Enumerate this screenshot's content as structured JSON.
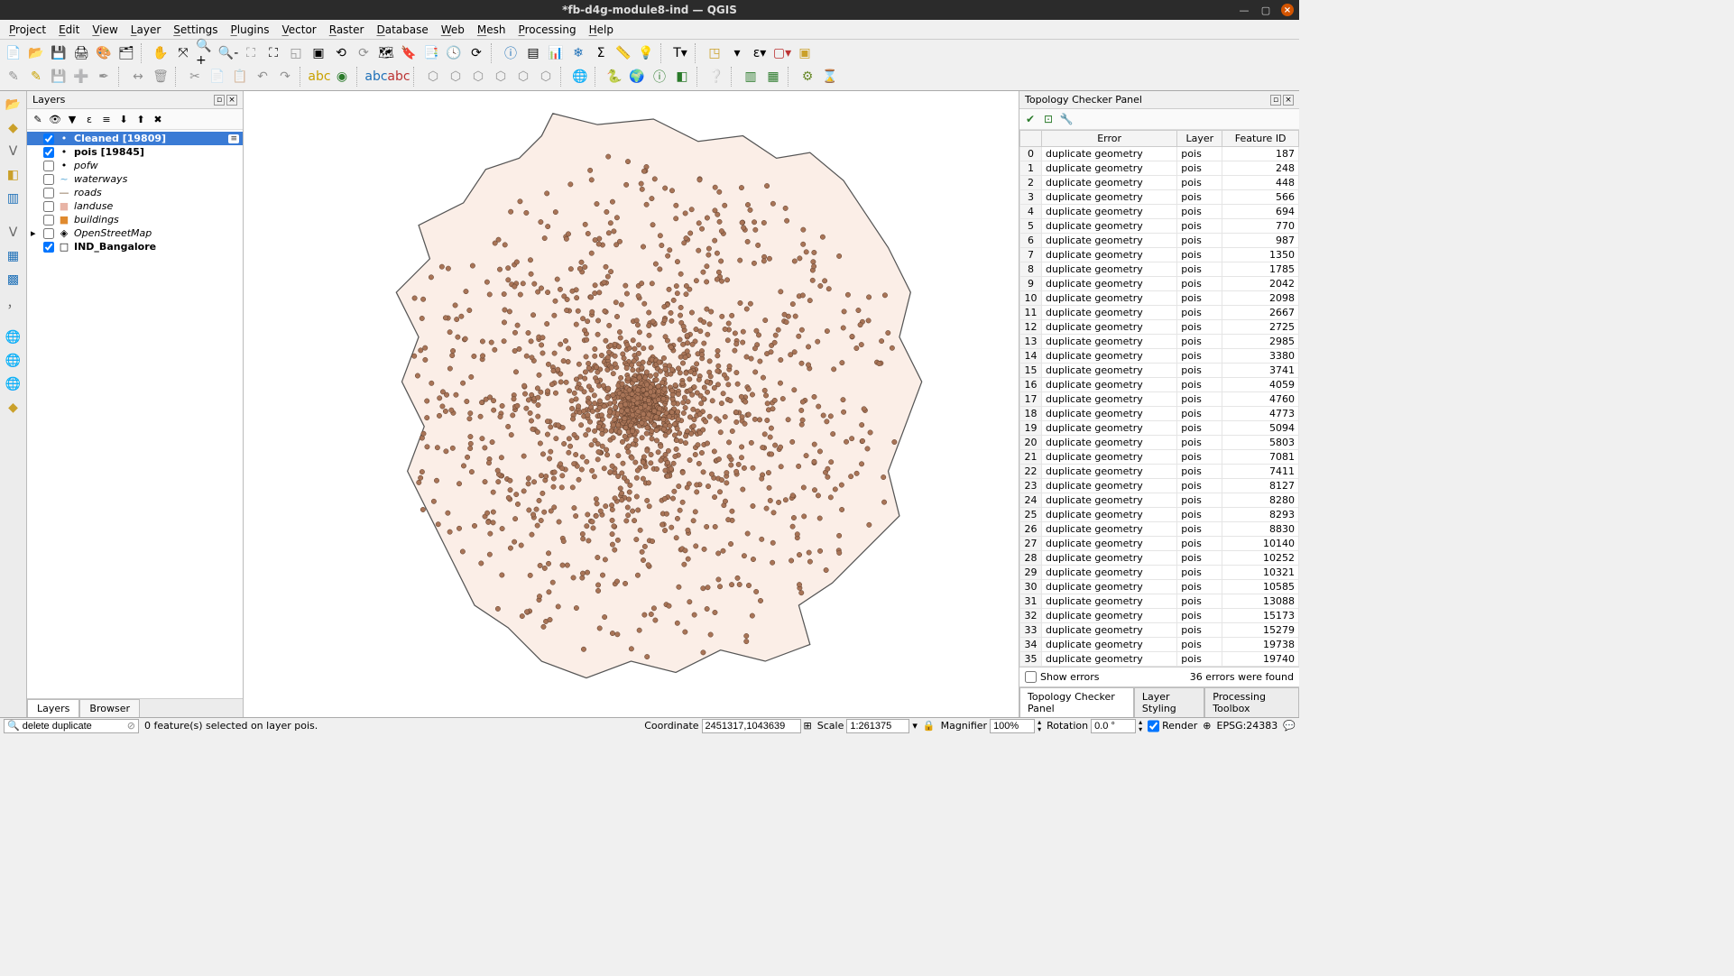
{
  "window": {
    "title": "*fb-d4g-module8-ind — QGIS"
  },
  "menu": [
    "Project",
    "Edit",
    "View",
    "Layer",
    "Settings",
    "Plugins",
    "Vector",
    "Raster",
    "Database",
    "Web",
    "Mesh",
    "Processing",
    "Help"
  ],
  "layersPanel": {
    "title": "Layers",
    "items": [
      {
        "checked": true,
        "sym": "•",
        "label": "Cleaned [19809]",
        "selected": true,
        "bold": true
      },
      {
        "checked": true,
        "sym": "•",
        "label": "pois [19845]",
        "bold": true
      },
      {
        "checked": false,
        "sym": "•",
        "label": "pofw",
        "italic": true
      },
      {
        "checked": false,
        "sym": "~",
        "label": "waterways",
        "italic": true,
        "symcolor": "#5aa9d6"
      },
      {
        "checked": false,
        "sym": "—",
        "label": "roads",
        "italic": true,
        "symcolor": "#7a5a3a"
      },
      {
        "checked": false,
        "sym": "■",
        "label": "landuse",
        "italic": true,
        "symcolor": "#e8b4a6"
      },
      {
        "checked": false,
        "sym": "■",
        "label": "buildings",
        "italic": true,
        "symcolor": "#e08a2e"
      },
      {
        "checked": false,
        "sym": "◈",
        "label": "OpenStreetMap",
        "italic": true,
        "expandable": true
      },
      {
        "checked": true,
        "sym": "□",
        "label": "IND_Bangalore",
        "bold": true
      }
    ],
    "tabs": [
      "Layers",
      "Browser"
    ]
  },
  "topologyPanel": {
    "title": "Topology Checker Panel",
    "columns": [
      "Error",
      "Layer",
      "Feature ID"
    ],
    "rows": [
      [
        "duplicate geometry",
        "pois",
        187
      ],
      [
        "duplicate geometry",
        "pois",
        248
      ],
      [
        "duplicate geometry",
        "pois",
        448
      ],
      [
        "duplicate geometry",
        "pois",
        566
      ],
      [
        "duplicate geometry",
        "pois",
        694
      ],
      [
        "duplicate geometry",
        "pois",
        770
      ],
      [
        "duplicate geometry",
        "pois",
        987
      ],
      [
        "duplicate geometry",
        "pois",
        1350
      ],
      [
        "duplicate geometry",
        "pois",
        1785
      ],
      [
        "duplicate geometry",
        "pois",
        2042
      ],
      [
        "duplicate geometry",
        "pois",
        2098
      ],
      [
        "duplicate geometry",
        "pois",
        2667
      ],
      [
        "duplicate geometry",
        "pois",
        2725
      ],
      [
        "duplicate geometry",
        "pois",
        2985
      ],
      [
        "duplicate geometry",
        "pois",
        3380
      ],
      [
        "duplicate geometry",
        "pois",
        3741
      ],
      [
        "duplicate geometry",
        "pois",
        4059
      ],
      [
        "duplicate geometry",
        "pois",
        4760
      ],
      [
        "duplicate geometry",
        "pois",
        4773
      ],
      [
        "duplicate geometry",
        "pois",
        5094
      ],
      [
        "duplicate geometry",
        "pois",
        5803
      ],
      [
        "duplicate geometry",
        "pois",
        7081
      ],
      [
        "duplicate geometry",
        "pois",
        7411
      ],
      [
        "duplicate geometry",
        "pois",
        8127
      ],
      [
        "duplicate geometry",
        "pois",
        8280
      ],
      [
        "duplicate geometry",
        "pois",
        8293
      ],
      [
        "duplicate geometry",
        "pois",
        8830
      ],
      [
        "duplicate geometry",
        "pois",
        10140
      ],
      [
        "duplicate geometry",
        "pois",
        10252
      ],
      [
        "duplicate geometry",
        "pois",
        10321
      ],
      [
        "duplicate geometry",
        "pois",
        10585
      ],
      [
        "duplicate geometry",
        "pois",
        13088
      ],
      [
        "duplicate geometry",
        "pois",
        15173
      ],
      [
        "duplicate geometry",
        "pois",
        15279
      ],
      [
        "duplicate geometry",
        "pois",
        19738
      ],
      [
        "duplicate geometry",
        "pois",
        19740
      ]
    ],
    "showErrorsLabel": "Show errors",
    "countText": "36 errors were found",
    "tabs": [
      "Topology Checker Panel",
      "Layer Styling",
      "Processing Toolbox"
    ]
  },
  "status": {
    "search": "delete duplicate",
    "selection": "0 feature(s) selected on layer pois.",
    "coordLabel": "Coordinate",
    "coord": "2451317,1043639",
    "scaleLabel": "Scale",
    "scale": "1:261375",
    "magLabel": "Magnifier",
    "mag": "100%",
    "rotLabel": "Rotation",
    "rot": "0.0 °",
    "renderLabel": "Render",
    "crs": "EPSG:24383"
  }
}
